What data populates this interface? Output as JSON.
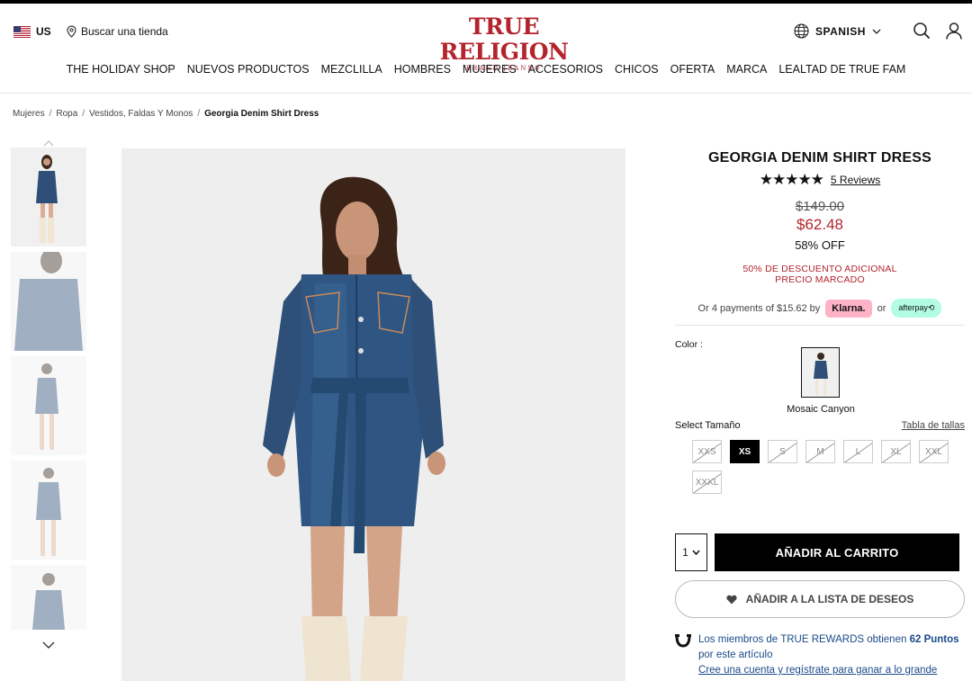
{
  "header": {
    "country": "US",
    "store_finder": "Buscar una tienda",
    "logo_main": "TRUE RELIGION",
    "logo_sub": "BRAND JEANS®",
    "language": "SPANISH"
  },
  "nav": {
    "items": [
      {
        "label": "THE HOLIDAY SHOP",
        "highlight": true
      },
      {
        "label": "NUEVOS PRODUCTOS",
        "highlight": false
      },
      {
        "label": "MEZCLILLA",
        "highlight": false
      },
      {
        "label": "HOMBRES",
        "highlight": false
      },
      {
        "label": "MUJERES",
        "highlight": false
      },
      {
        "label": "ACCESORIOS",
        "highlight": false
      },
      {
        "label": "CHICOS",
        "highlight": false
      },
      {
        "label": "OFERTA",
        "highlight": true
      },
      {
        "label": "MARCA",
        "highlight": false
      },
      {
        "label": "LEALTAD DE TRUE FAM",
        "highlight": false
      }
    ]
  },
  "breadcrumb": {
    "items": [
      "Mujeres",
      "Ropa",
      "Vestidos, Faldas Y Monos"
    ],
    "current": "Georgia Denim Shirt Dress"
  },
  "product": {
    "title": "GEORGIA DENIM SHIRT DRESS",
    "stars": "★★★★★",
    "reviews": "5 Reviews",
    "price_old": "$149.00",
    "price_new": "$62.48",
    "off": "58% OFF",
    "promo_line1": "50% DE DESCUENTO ADICIONAL",
    "promo_line2": "PRECIO MARCADO",
    "payments_text": "Or 4 payments of $15.62 by",
    "klarna": "Klarna.",
    "or": "or",
    "afterpay": "afterpay⟲",
    "color_label": "Color :",
    "color_name": "Mosaic Canyon",
    "size_label": "Select Tamaño",
    "size_chart": "Tabla de tallas",
    "sizes": [
      {
        "label": "XXS",
        "available": false,
        "selected": false
      },
      {
        "label": "XS",
        "available": true,
        "selected": true
      },
      {
        "label": "S",
        "available": false,
        "selected": false
      },
      {
        "label": "M",
        "available": false,
        "selected": false
      },
      {
        "label": "L",
        "available": false,
        "selected": false
      },
      {
        "label": "XL",
        "available": false,
        "selected": false
      },
      {
        "label": "XXL",
        "available": false,
        "selected": false
      },
      {
        "label": "XXXL",
        "available": false,
        "selected": false
      }
    ],
    "quantity": "1",
    "add_to_cart": "AÑADIR AL CARRITO",
    "wishlist": "AÑADIR A LA LISTA DE DESEOS",
    "rewards_prefix": "Los miembros de TRUE REWARDS obtienen",
    "rewards_points": "62 Puntos",
    "rewards_suffix": "por este artículo",
    "rewards_link": "Cree una cuenta y regístrate para ganar a lo grande"
  },
  "colors": {
    "brand_red": "#b3242d",
    "denim": "#2f4f78",
    "klarna_pink": "#ffb3c7",
    "afterpay_mint": "#b2fce4"
  }
}
